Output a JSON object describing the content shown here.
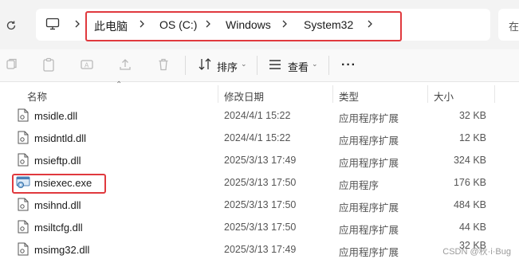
{
  "address_bar": {
    "breadcrumbs": [
      {
        "label": "此电脑"
      },
      {
        "label": "OS (C:)"
      },
      {
        "label": "Windows"
      },
      {
        "label": "System32"
      }
    ],
    "search_stub": "在"
  },
  "toolbar": {
    "sort_label": "排序",
    "view_label": "查看",
    "more_label": "···"
  },
  "columns": {
    "name": "名称",
    "date": "修改日期",
    "type": "类型",
    "size": "大小"
  },
  "files": [
    {
      "name": "msidle.dll",
      "date": "2024/4/1 15:22",
      "type": "应用程序扩展",
      "size": "32 KB",
      "icon": "dll-file-icon"
    },
    {
      "name": "msidntld.dll",
      "date": "2024/4/1 15:22",
      "type": "应用程序扩展",
      "size": "12 KB",
      "icon": "dll-file-icon"
    },
    {
      "name": "msieftp.dll",
      "date": "2025/3/13 17:49",
      "type": "应用程序扩展",
      "size": "324 KB",
      "icon": "dll-file-icon"
    },
    {
      "name": "msiexec.exe",
      "date": "2025/3/13 17:50",
      "type": "应用程序",
      "size": "176 KB",
      "icon": "installer-exe-icon"
    },
    {
      "name": "msihnd.dll",
      "date": "2025/3/13 17:50",
      "type": "应用程序扩展",
      "size": "484 KB",
      "icon": "dll-file-icon"
    },
    {
      "name": "msiltcfg.dll",
      "date": "2025/3/13 17:50",
      "type": "应用程序扩展",
      "size": "44 KB",
      "icon": "dll-file-icon"
    },
    {
      "name": "msimg32.dll",
      "date": "2025/3/13 17:49",
      "type": "应用程序扩展",
      "size": "32 KB",
      "icon": "dll-file-icon"
    }
  ],
  "watermark": "CSDN @秋·i·Bug",
  "colors": {
    "highlight_box": "#e0393e",
    "address_background": "#f3f3f3",
    "toolbar_background": "#f9f9f9"
  }
}
